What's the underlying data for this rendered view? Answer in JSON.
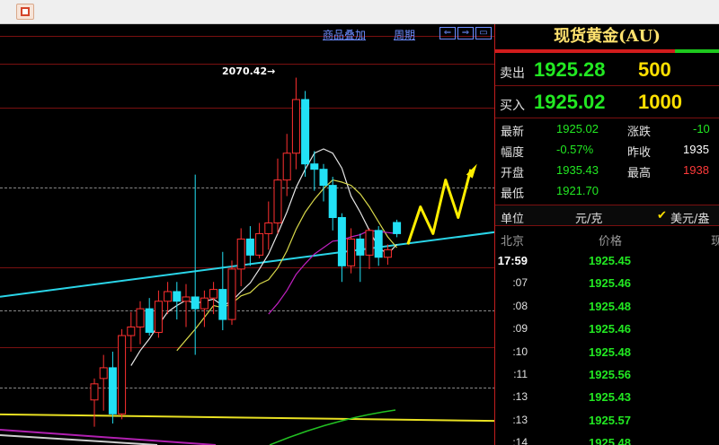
{
  "toolbar": {
    "overlay_label": "商品叠加",
    "period_label": "周期"
  },
  "chart": {
    "peak_label": "2070.42→",
    "colors": {
      "bull": "#ff3030",
      "bear": "#22e1f5",
      "ma1": "#e6e6e6",
      "ma2": "#d8d84a",
      "ma3": "#c020c0",
      "ma4": "#22c022"
    }
  },
  "chart_data": {
    "type": "candlestick",
    "annotations": [
      "2070.42"
    ],
    "candles": [
      {
        "o": 1770,
        "h": 1790,
        "l": 1745,
        "c": 1785
      },
      {
        "o": 1790,
        "h": 1812,
        "l": 1760,
        "c": 1800
      },
      {
        "o": 1800,
        "h": 1815,
        "l": 1748,
        "c": 1757
      },
      {
        "o": 1757,
        "h": 1836,
        "l": 1752,
        "c": 1830
      },
      {
        "o": 1830,
        "h": 1852,
        "l": 1815,
        "c": 1838
      },
      {
        "o": 1838,
        "h": 1862,
        "l": 1822,
        "c": 1855
      },
      {
        "o": 1855,
        "h": 1865,
        "l": 1830,
        "c": 1833
      },
      {
        "o": 1833,
        "h": 1872,
        "l": 1828,
        "c": 1862
      },
      {
        "o": 1862,
        "h": 1880,
        "l": 1850,
        "c": 1871
      },
      {
        "o": 1871,
        "h": 1880,
        "l": 1845,
        "c": 1862
      },
      {
        "o": 1862,
        "h": 1878,
        "l": 1838,
        "c": 1866
      },
      {
        "o": 1866,
        "h": 1980,
        "l": 1812,
        "c": 1855
      },
      {
        "o": 1855,
        "h": 1872,
        "l": 1838,
        "c": 1865
      },
      {
        "o": 1865,
        "h": 1880,
        "l": 1850,
        "c": 1873
      },
      {
        "o": 1873,
        "h": 1908,
        "l": 1835,
        "c": 1845
      },
      {
        "o": 1845,
        "h": 1900,
        "l": 1840,
        "c": 1892
      },
      {
        "o": 1892,
        "h": 1930,
        "l": 1876,
        "c": 1920
      },
      {
        "o": 1920,
        "h": 1932,
        "l": 1895,
        "c": 1905
      },
      {
        "o": 1905,
        "h": 1935,
        "l": 1902,
        "c": 1925
      },
      {
        "o": 1925,
        "h": 1955,
        "l": 1910,
        "c": 1935
      },
      {
        "o": 1935,
        "h": 1995,
        "l": 1925,
        "c": 1975
      },
      {
        "o": 1975,
        "h": 2018,
        "l": 1960,
        "c": 2000
      },
      {
        "o": 2000,
        "h": 2070.42,
        "l": 1985,
        "c": 2050
      },
      {
        "o": 2050,
        "h": 2058,
        "l": 1978,
        "c": 1990
      },
      {
        "o": 1990,
        "h": 2002,
        "l": 1965,
        "c": 1985
      },
      {
        "o": 1985,
        "h": 1990,
        "l": 1955,
        "c": 1970
      },
      {
        "o": 1970,
        "h": 1978,
        "l": 1928,
        "c": 1940
      },
      {
        "o": 1940,
        "h": 1944,
        "l": 1880,
        "c": 1895
      },
      {
        "o": 1895,
        "h": 1930,
        "l": 1888,
        "c": 1920
      },
      {
        "o": 1920,
        "h": 1925,
        "l": 1880,
        "c": 1905
      },
      {
        "o": 1905,
        "h": 1930,
        "l": 1892,
        "c": 1928
      },
      {
        "o": 1928,
        "h": 1932,
        "l": 1895,
        "c": 1903
      },
      {
        "o": 1903,
        "h": 1915,
        "l": 1896,
        "c": 1910
      },
      {
        "o": 1935.43,
        "h": 1938,
        "l": 1921.7,
        "c": 1925.02
      }
    ],
    "ma_lines": [
      {
        "name": "MA5",
        "values": [
          null,
          null,
          null,
          null,
          1802,
          1816,
          1827,
          1840,
          1852,
          1858,
          1863,
          1860,
          1862,
          1864,
          1858,
          1862,
          1871,
          1879,
          1892,
          1906,
          1925,
          1945,
          1968,
          1985,
          2000,
          2004,
          2000,
          1986,
          1960,
          1945,
          1928,
          1912,
          1906,
          1915
        ]
      },
      {
        "name": "MA10",
        "values": [
          null,
          null,
          null,
          null,
          null,
          null,
          null,
          null,
          null,
          1816,
          1826,
          1836,
          1847,
          1858,
          1856,
          1860,
          1867,
          1870,
          1878,
          1882,
          1893,
          1909,
          1929,
          1945,
          1957,
          1967,
          1975,
          1973,
          1970,
          1962,
          1950,
          1936,
          1922,
          1912
        ]
      },
      {
        "name": "MA20",
        "values": [
          null,
          null,
          null,
          null,
          null,
          null,
          null,
          null,
          null,
          null,
          null,
          null,
          null,
          null,
          null,
          null,
          null,
          null,
          null,
          1850,
          1860,
          1872,
          1887,
          1897,
          1906,
          1912,
          1918,
          1919,
          1922,
          1924,
          1928,
          1927,
          1926,
          1925
        ]
      }
    ],
    "channel": {
      "upper": [
        1862,
        1985
      ],
      "lower": [
        1790,
        1855
      ],
      "prediction": [
        1915,
        1950,
        1925,
        1975,
        1940,
        1985
      ]
    }
  },
  "quote": {
    "title": "现货黄金(AU)",
    "sell_label": "卖出",
    "sell_price": "1925.28",
    "sell_volume": "500",
    "buy_label": "买入",
    "buy_price": "1925.02",
    "buy_volume": "1000",
    "stats": {
      "latest_label": "最新",
      "latest": "1925.02",
      "change_label": "涨跌",
      "change": "-10",
      "amp_label": "幅度",
      "amp": "-0.57%",
      "prev_close_label": "昨收",
      "prev_close": "1935",
      "open_label": "开盘",
      "open": "1935.43",
      "high_label": "最高",
      "high": "1938",
      "low_label": "最低",
      "low": "1921.70"
    },
    "unit_label": "单位",
    "unit": "元/克",
    "currency": "美元/盎",
    "ticks_header": {
      "city": "北京",
      "price": "价格",
      "qty": "现"
    },
    "ticks": [
      {
        "time": "17:59",
        "price": "1925.45"
      },
      {
        "time": ":07",
        "price": "1925.46"
      },
      {
        "time": ":08",
        "price": "1925.48"
      },
      {
        "time": ":09",
        "price": "1925.46"
      },
      {
        "time": ":10",
        "price": "1925.48"
      },
      {
        "time": ":11",
        "price": "1925.56"
      },
      {
        "time": ":13",
        "price": "1925.43"
      },
      {
        "time": ":13",
        "price": "1925.57"
      },
      {
        "time": ":14",
        "price": "1925.48"
      }
    ]
  }
}
